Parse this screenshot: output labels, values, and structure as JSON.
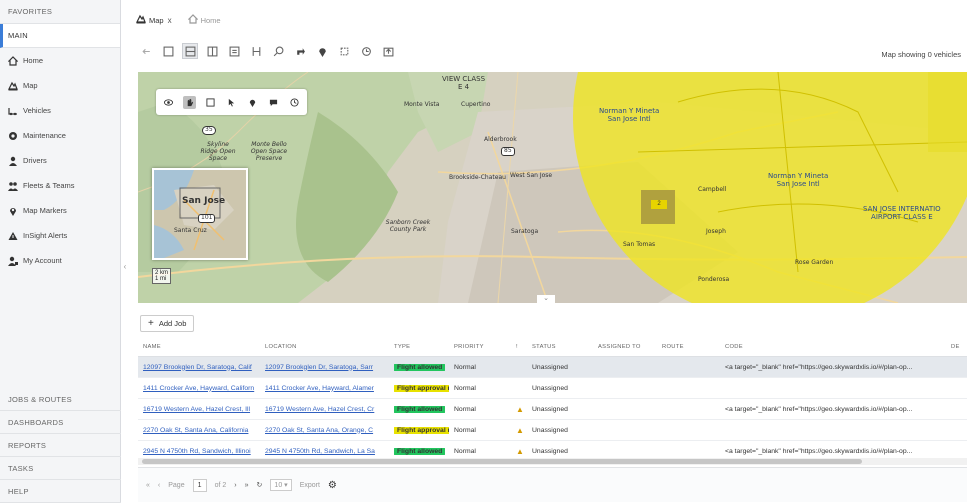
{
  "sidebar": {
    "favorites_label": "FAVORITES",
    "main_label": "MAIN",
    "items": [
      {
        "label": "Home",
        "icon": "home-icon"
      },
      {
        "label": "Map",
        "icon": "map-icon"
      },
      {
        "label": "Vehicles",
        "icon": "vehicles-icon"
      },
      {
        "label": "Maintenance",
        "icon": "maintenance-icon"
      },
      {
        "label": "Drivers",
        "icon": "drivers-icon"
      },
      {
        "label": "Fleets & Teams",
        "icon": "fleets-icon"
      },
      {
        "label": "Map Markers",
        "icon": "map-marker-icon"
      },
      {
        "label": "InSight Alerts",
        "icon": "alert-icon"
      },
      {
        "label": "My Account",
        "icon": "account-icon"
      }
    ],
    "bottom_sections": [
      "JOBS & ROUTES",
      "DASHBOARDS",
      "REPORTS",
      "TASKS",
      "HELP"
    ]
  },
  "tabs": [
    {
      "label": "Map",
      "close": "x",
      "active": true
    },
    {
      "label": "Home",
      "active": false
    }
  ],
  "toolbar": {
    "status_text": "Map showing 0 vehicles",
    "buttons": [
      "back-icon",
      "square-icon",
      "split-view-icon",
      "layout-icon",
      "list-icon",
      "route-icon",
      "search-location-icon",
      "directions-icon",
      "pin-icon",
      "geofence-icon",
      "history-icon",
      "export-icon"
    ]
  },
  "map": {
    "labels": {
      "view_class": "VIEW CLASS",
      "view_class_sub": "E 4",
      "monte_vista": "Monte Vista",
      "cupertino": "Cupertino",
      "airport_1": "Norman Y Mineta",
      "airport_1b": "San Jose Intl",
      "airport_2": "Norman Y Mineta",
      "airport_2b": "San Jose Intl",
      "sj_class": "SAN JOSE INTERNATIO",
      "sj_class_b": "AIRPORT CLASS E",
      "alderbrook": "Alderbrook",
      "brookside": "Brookside-Chateau",
      "saratoga": "Saratoga",
      "west_san_jose": "West San Jose",
      "san_tomas": "San Tomas",
      "joseph": "Joseph",
      "ponderosa": "Ponderosa",
      "campbell": "Campbell",
      "rose_garden": "Rose Garden",
      "skyline": "Skyline Ridge Open Space",
      "monte_bello": "Monte Bello Open Space Preserve",
      "sanborn": "Sanborn Creek County Park",
      "inset_city": "San Jose",
      "inset_santa_cruz": "Santa Cruz",
      "inset_road": "101",
      "route_85": "85",
      "route_35": "35",
      "cluster_count": "2",
      "scale": "2 km",
      "scale_mi": "1 mi"
    }
  },
  "add_job_label": "Add Job",
  "table": {
    "headers": [
      "NAME",
      "LOCATION",
      "TYPE",
      "PRIORITY",
      "!",
      "STATUS",
      "ASSIGNED TO",
      "ROUTE",
      "CODE",
      "DE"
    ],
    "rows": [
      {
        "name": "12097 Brookglen Dr, Saratoga, Calif",
        "location": "12097 Brookglen Dr, Saratoga, Sarr",
        "type": "Flight allowed",
        "type_color": "#22c55e",
        "priority": "Normal",
        "warn": "",
        "status": "Unassigned",
        "code": "<a target=\"_blank\" href=\"https://geo.skywardxlis.io/#/plan-op...",
        "selected": true
      },
      {
        "name": "1411 Crocker Ave, Hayward, Californ",
        "location": "1411 Crocker Ave, Hayward, Alamer",
        "type": "Flight approval re",
        "type_color": "#e8e200",
        "priority": "Normal",
        "warn": "",
        "status": "Unassigned",
        "code": "",
        "selected": false
      },
      {
        "name": "16719 Western Ave, Hazel Crest, Ill",
        "location": "16719 Western Ave, Hazel Crest, Cr",
        "type": "Flight allowed",
        "type_color": "#22c55e",
        "priority": "Normal",
        "warn": "▲",
        "status": "Unassigned",
        "code": "<a target=\"_blank\" href=\"https://geo.skywardxlis.io/#/plan-op...",
        "selected": false
      },
      {
        "name": "2270 Oak St, Santa Ana, California",
        "location": "2270 Oak St, Santa Ana, Orange, C",
        "type": "Flight approval re",
        "type_color": "#e8e200",
        "priority": "Normal",
        "warn": "▲",
        "status": "Unassigned",
        "code": "",
        "selected": false
      },
      {
        "name": "2945 N 4750th Rd, Sandwich, Illinoi",
        "location": "2945 N 4750th Rd, Sandwich, La Sa",
        "type": "Flight allowed",
        "type_color": "#22c55e",
        "priority": "Normal",
        "warn": "▲",
        "status": "Unassigned",
        "code": "<a target=\"_blank\" href=\"https://geo.skywardxlis.io/#/plan-op...",
        "selected": false
      }
    ]
  },
  "pager": {
    "page_label": "Page",
    "page_value": "1",
    "of_label": "of 2",
    "per_page": "10",
    "export_label": "Export"
  }
}
